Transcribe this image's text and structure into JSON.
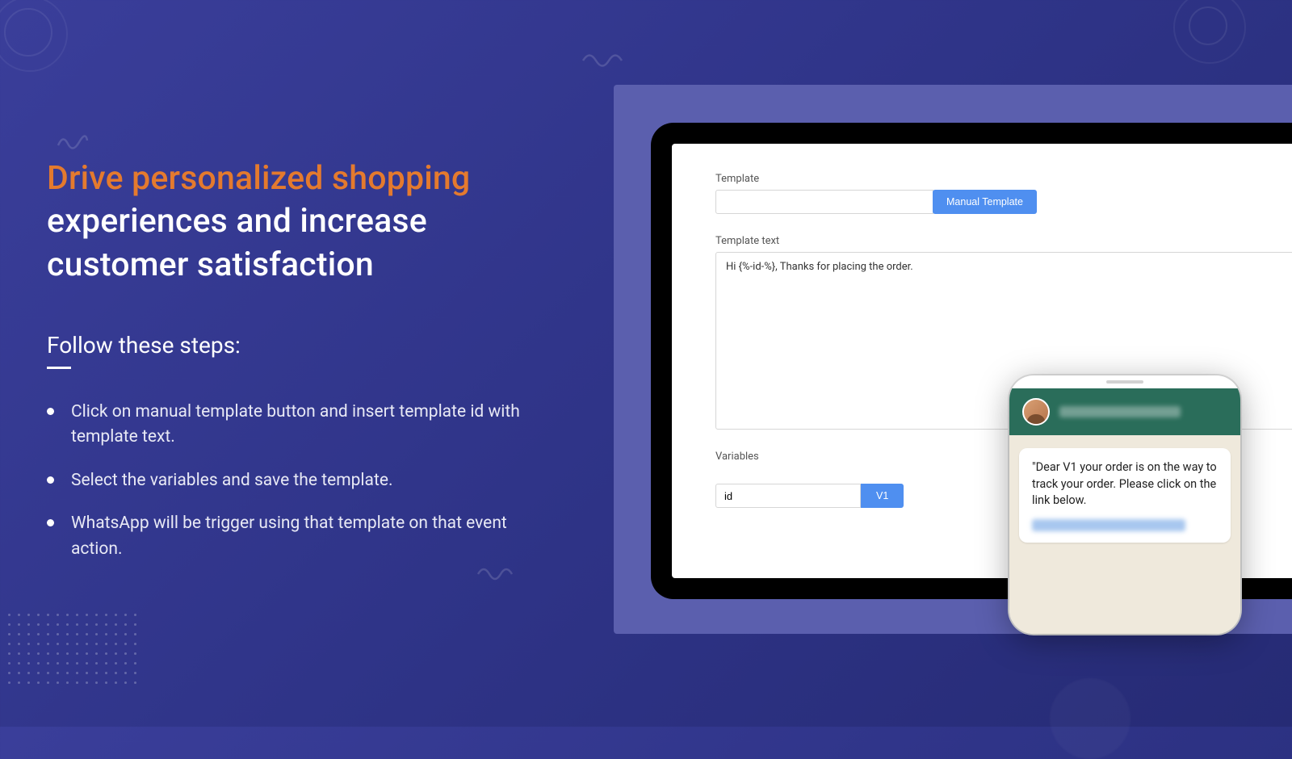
{
  "headline": {
    "accent": "Drive personalized shopping",
    "rest": " experiences and increase customer satisfaction"
  },
  "steps_title": "Follow these steps:",
  "steps": [
    "Click on manual template button and insert template id with template text.",
    "Select the variables and save the template.",
    "WhatsApp will be trigger using that template on that event action."
  ],
  "form": {
    "template_label": "Template",
    "manual_template_btn": "Manual Template",
    "template_text_label": "Template text",
    "template_text_value": "Hi {%-id-%}, Thanks for placing the order.",
    "variables_label": "Variables",
    "variable_value": "id",
    "variable_btn": "V1"
  },
  "phone": {
    "message": "\"Dear V1 your order is on the way to track your order. Please click on the link below."
  }
}
